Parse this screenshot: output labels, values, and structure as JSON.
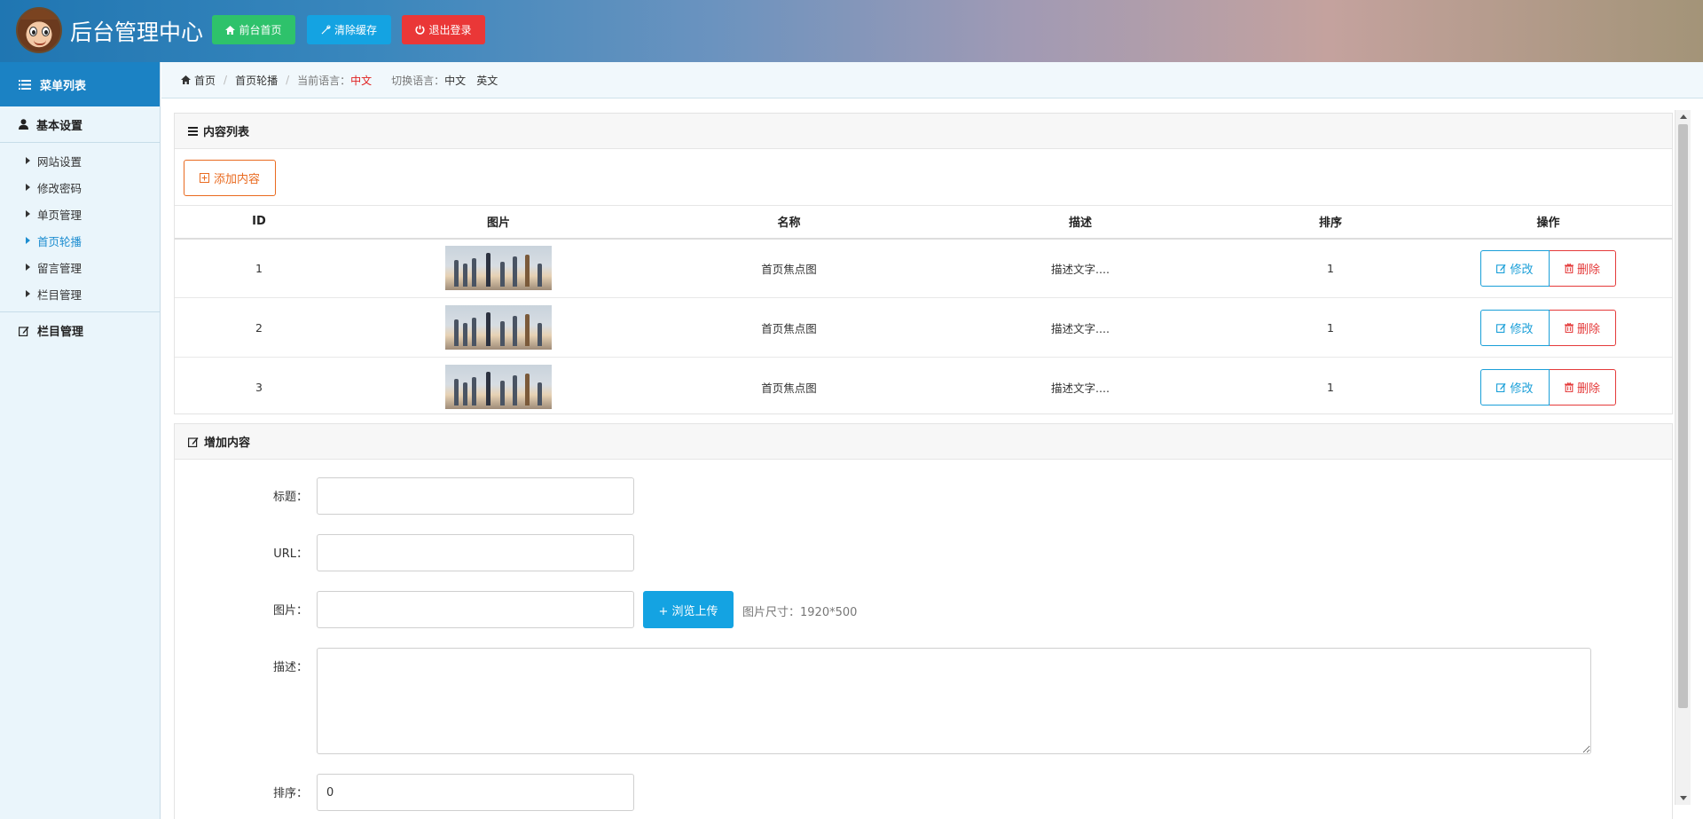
{
  "header": {
    "title": "后台管理中心",
    "buttons": {
      "home": "前台首页",
      "cache": "清除缓存",
      "logout": "退出登录"
    }
  },
  "sidebar": {
    "head": "菜单列表",
    "groups": [
      {
        "label": "基本设置",
        "icon": "user-icon",
        "items": [
          "网站设置",
          "修改密码",
          "单页管理",
          "首页轮播",
          "留言管理",
          "栏目管理"
        ],
        "active": "首页轮播"
      },
      {
        "label": "栏目管理",
        "icon": "edit-icon",
        "items": []
      }
    ]
  },
  "breadcrumb": {
    "home": "首页",
    "current": "首页轮播",
    "lang_label": "当前语言：",
    "lang_value": "中文",
    "switch_label": "切换语言：",
    "switch_zh": "中文",
    "switch_en": "英文"
  },
  "list_panel": {
    "title": "内容列表",
    "add_button": "添加内容",
    "columns": [
      "ID",
      "图片",
      "名称",
      "描述",
      "排序",
      "操作"
    ],
    "rows": [
      {
        "id": "1",
        "name": "首页焦点图",
        "desc": "描述文字....",
        "sort": "1"
      },
      {
        "id": "2",
        "name": "首页焦点图",
        "desc": "描述文字....",
        "sort": "1"
      },
      {
        "id": "3",
        "name": "首页焦点图",
        "desc": "描述文字....",
        "sort": "1"
      }
    ],
    "edit_label": "修改",
    "delete_label": "删除"
  },
  "add_panel": {
    "title": "增加内容",
    "fields": {
      "title_label": "标题：",
      "url_label": "URL：",
      "image_label": "图片：",
      "desc_label": "描述：",
      "sort_label": "排序：",
      "title_value": "",
      "url_value": "",
      "image_value": "",
      "desc_value": "",
      "sort_value": "0"
    },
    "upload_button": "+ 浏览上传",
    "upload_hint": "图片尺寸：1920*500"
  },
  "colors": {
    "sidebar_head": "#1b82c4",
    "green_button": "#2ec26b",
    "blue_button": "#14a3e2",
    "red_button": "#ea3737",
    "add_button": "#e96a1f"
  }
}
